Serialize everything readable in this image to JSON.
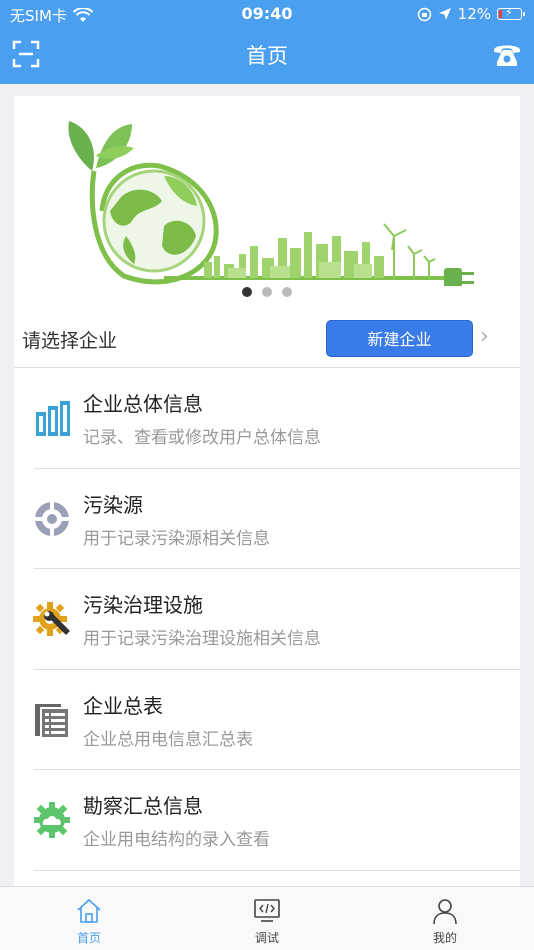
{
  "status_bar": {
    "carrier": "无SIM卡",
    "time": "09:40",
    "battery": "12%"
  },
  "nav": {
    "title": "首页",
    "scan_icon": "scan-icon",
    "phone_icon": "phone-icon"
  },
  "banner": {
    "slide_count": 3,
    "active_slide": 1
  },
  "company_select": {
    "label": "请选择企业",
    "new_button": "新建企业",
    "chevron": "›"
  },
  "menu": [
    {
      "title": "企业总体信息",
      "subtitle": "记录、查看或修改用户总体信息",
      "icon": "building-icon"
    },
    {
      "title": "污染源",
      "subtitle": "用于记录污染源相关信息",
      "icon": "pollution-source-icon"
    },
    {
      "title": "污染治理设施",
      "subtitle": "用于记录污染治理设施相关信息",
      "icon": "gear-wrench-icon"
    },
    {
      "title": "企业总表",
      "subtitle": "企业总用电信息汇总表",
      "icon": "document-list-icon"
    },
    {
      "title": "勘察汇总信息",
      "subtitle": "企业用电结构的录入查看",
      "icon": "gear-cloud-icon"
    }
  ],
  "tabs": [
    {
      "label": "首页",
      "icon": "home-icon",
      "active": true
    },
    {
      "label": "调试",
      "icon": "code-monitor-icon",
      "active": false
    },
    {
      "label": "我的",
      "icon": "user-icon",
      "active": false
    }
  ],
  "colors": {
    "header": "#4a9ff0",
    "primary_button": "#3a7bea",
    "active_tab": "#4a9ff0"
  }
}
